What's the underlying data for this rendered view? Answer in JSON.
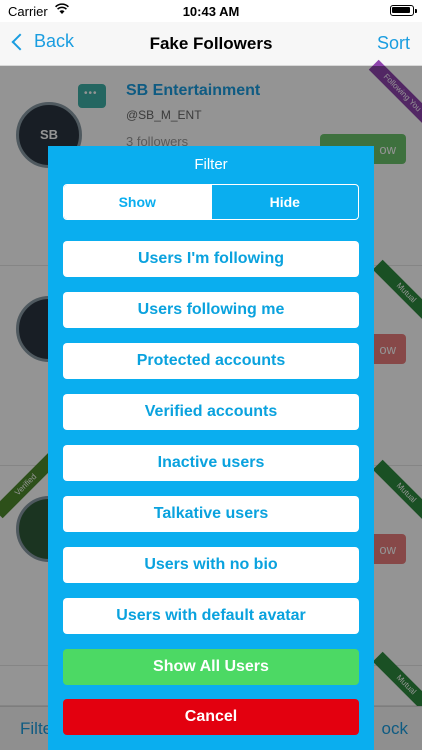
{
  "status": {
    "carrier": "Carrier",
    "time": "10:43 AM"
  },
  "nav": {
    "back": "Back",
    "title": "Fake Followers",
    "sort": "Sort"
  },
  "list": {
    "first_name": "SB Entertainment",
    "first_handle": "@SB_M_ENT",
    "first_followers": "3 followers",
    "avatar_text": "SB",
    "ribbons": [
      "Following You",
      "Mutual",
      "Verified",
      "Mutual",
      "Mutual"
    ],
    "btn_text": "ow"
  },
  "bottom": {
    "left": "Filte",
    "right": "ock"
  },
  "filter": {
    "title": "Filter",
    "show_label": "Show",
    "hide_label": "Hide",
    "options": [
      "Users I'm following",
      "Users following me",
      "Protected accounts",
      "Verified accounts",
      "Inactive users",
      "Talkative users",
      "Users with no bio",
      "Users with default avatar"
    ],
    "show_all": "Show All Users",
    "cancel": "Cancel"
  },
  "colors": {
    "accent": "#0aaeef",
    "link": "#1a9de0",
    "show_all": "#4cd964",
    "cancel": "#e3000f"
  }
}
